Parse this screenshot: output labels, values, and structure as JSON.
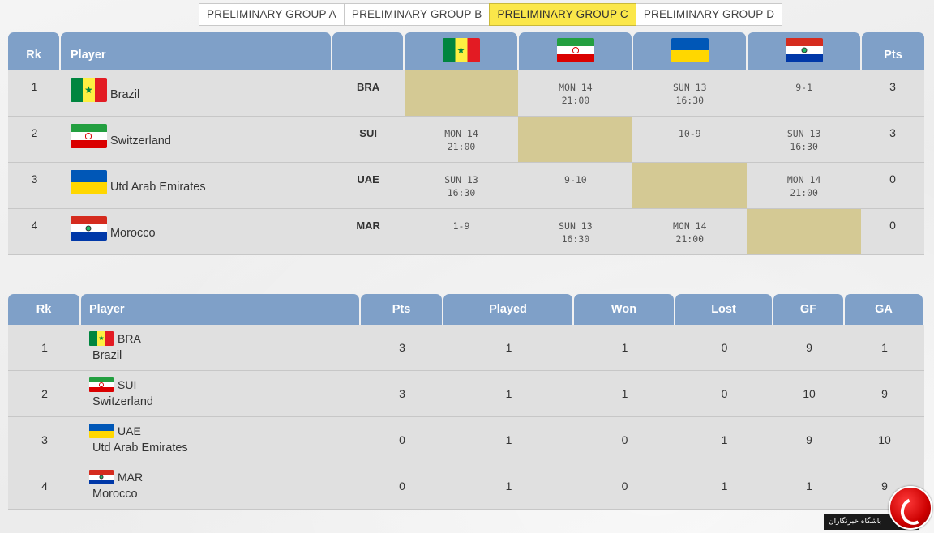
{
  "tabs": [
    {
      "label": "PRELIMINARY GROUP A",
      "active": false
    },
    {
      "label": "PRELIMINARY GROUP B",
      "active": false
    },
    {
      "label": "PRELIMINARY GROUP C",
      "active": true
    },
    {
      "label": "PRELIMINARY GROUP D",
      "active": false
    }
  ],
  "results": {
    "headers": {
      "rk": "Rk",
      "player": "Player",
      "pts": "Pts"
    },
    "column_flags": [
      "flag-senegal-icon",
      "flag-iran-icon",
      "flag-ukraine-icon",
      "flag-paraguay-icon"
    ],
    "rows": [
      {
        "rk": "1",
        "name": "Brazil",
        "code": "BRA",
        "flag": "flag-senegal-icon",
        "matches": [
          {
            "l1": "",
            "l2": ""
          },
          {
            "l1": "MON 14",
            "l2": "21:00"
          },
          {
            "l1": "SUN 13",
            "l2": "16:30"
          },
          {
            "l1": "9-1",
            "l2": ""
          }
        ],
        "pts": "3"
      },
      {
        "rk": "2",
        "name": "Switzerland",
        "code": "SUI",
        "flag": "flag-iran-icon",
        "matches": [
          {
            "l1": "MON 14",
            "l2": "21:00"
          },
          {
            "l1": "",
            "l2": ""
          },
          {
            "l1": "10-9",
            "l2": ""
          },
          {
            "l1": "SUN 13",
            "l2": "16:30"
          }
        ],
        "pts": "3"
      },
      {
        "rk": "3",
        "name": "Utd Arab Emirates",
        "code": "UAE",
        "flag": "flag-ukraine-icon",
        "matches": [
          {
            "l1": "SUN 13",
            "l2": "16:30"
          },
          {
            "l1": "9-10",
            "l2": ""
          },
          {
            "l1": "",
            "l2": ""
          },
          {
            "l1": "MON 14",
            "l2": "21:00"
          }
        ],
        "pts": "0"
      },
      {
        "rk": "4",
        "name": "Morocco",
        "code": "MAR",
        "flag": "flag-paraguay-icon",
        "matches": [
          {
            "l1": "1-9",
            "l2": ""
          },
          {
            "l1": "SUN 13",
            "l2": "16:30"
          },
          {
            "l1": "MON 14",
            "l2": "21:00"
          },
          {
            "l1": "",
            "l2": ""
          }
        ],
        "pts": "0"
      }
    ]
  },
  "standings": {
    "headers": {
      "rk": "Rk",
      "player": "Player",
      "pts": "Pts",
      "played": "Played",
      "won": "Won",
      "lost": "Lost",
      "gf": "GF",
      "ga": "GA"
    },
    "rows": [
      {
        "rk": "1",
        "code": "BRA",
        "name": "Brazil",
        "flag": "flag-senegal-icon",
        "pts": "3",
        "played": "1",
        "won": "1",
        "lost": "0",
        "gf": "9",
        "ga": "1"
      },
      {
        "rk": "2",
        "code": "SUI",
        "name": "Switzerland",
        "flag": "flag-iran-icon",
        "pts": "3",
        "played": "1",
        "won": "1",
        "lost": "0",
        "gf": "10",
        "ga": "9"
      },
      {
        "rk": "3",
        "code": "UAE",
        "name": "Utd Arab Emirates",
        "flag": "flag-ukraine-icon",
        "pts": "0",
        "played": "1",
        "won": "0",
        "lost": "1",
        "gf": "9",
        "ga": "10"
      },
      {
        "rk": "4",
        "code": "MAR",
        "name": "Morocco",
        "flag": "flag-paraguay-icon",
        "pts": "0",
        "played": "1",
        "won": "0",
        "lost": "1",
        "gf": "1",
        "ga": "9"
      }
    ]
  },
  "watermark": {
    "text": "باشگاه خبرنگاران"
  },
  "colors": {
    "header": "#7fa0c8",
    "active_tab": "#fbe74a",
    "self_cell": "#d4c994",
    "row": "#e0e0e0"
  }
}
